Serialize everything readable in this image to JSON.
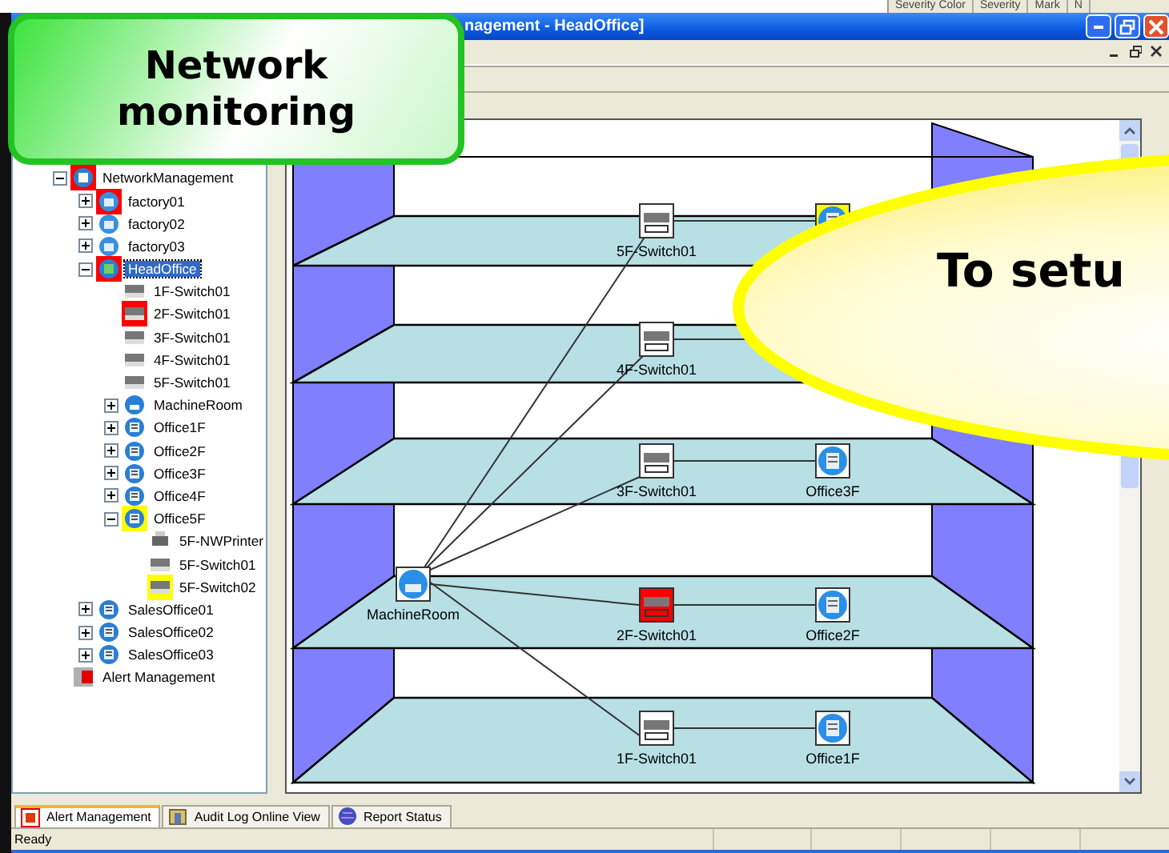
{
  "background_window": {
    "columns": [
      "Severity Color",
      "Severity",
      "Mark",
      "N"
    ]
  },
  "window": {
    "title": "nagement - HeadOffice]"
  },
  "tree": [
    {
      "label": "NetworkManagement",
      "kind": "root",
      "color": "#ff0000",
      "expanded": true,
      "selected": false,
      "children": [
        {
          "label": "factory01",
          "kind": "site",
          "color": "#ff0000",
          "expanded": false,
          "selected": false
        },
        {
          "label": "factory02",
          "kind": "site",
          "expanded": false,
          "selected": false
        },
        {
          "label": "factory03",
          "kind": "site",
          "expanded": false,
          "selected": false
        },
        {
          "label": "HeadOffice",
          "kind": "head",
          "color": "#ff0000",
          "expanded": true,
          "selected": true,
          "children": [
            {
              "label": "1F-Switch01",
              "kind": "switch",
              "selected": false
            },
            {
              "label": "2F-Switch01",
              "kind": "switch",
              "color": "#ff0000",
              "selected": false
            },
            {
              "label": "3F-Switch01",
              "kind": "switch",
              "selected": false
            },
            {
              "label": "4F-Switch01",
              "kind": "switch",
              "selected": false
            },
            {
              "label": "5F-Switch01",
              "kind": "switch",
              "selected": false
            },
            {
              "label": "MachineRoom",
              "kind": "room",
              "expanded": false,
              "selected": false
            },
            {
              "label": "Office1F",
              "kind": "office",
              "expanded": false,
              "selected": false
            },
            {
              "label": "Office2F",
              "kind": "office",
              "expanded": false,
              "selected": false
            },
            {
              "label": "Office3F",
              "kind": "office",
              "expanded": false,
              "selected": false
            },
            {
              "label": "Office4F",
              "kind": "office",
              "expanded": false,
              "selected": false
            },
            {
              "label": "Office5F",
              "kind": "office",
              "color": "#ffff00",
              "expanded": true,
              "selected": false,
              "children": [
                {
                  "label": "5F-NWPrinter",
                  "kind": "printer",
                  "selected": false
                },
                {
                  "label": "5F-Switch01",
                  "kind": "switch",
                  "selected": false
                },
                {
                  "label": "5F-Switch02",
                  "kind": "switch",
                  "color": "#ffff00",
                  "selected": false
                }
              ]
            }
          ]
        },
        {
          "label": "SalesOffice01",
          "kind": "office",
          "expanded": false,
          "selected": false
        },
        {
          "label": "SalesOffice02",
          "kind": "office",
          "expanded": false,
          "selected": false
        },
        {
          "label": "SalesOffice03",
          "kind": "office",
          "expanded": false,
          "selected": false
        }
      ]
    },
    {
      "label": "Alert Management",
      "kind": "alert",
      "selected": false
    }
  ],
  "floors": [
    {
      "nodes": [
        {
          "kind": "switch",
          "label": "5F-Switch01",
          "uplink": true
        },
        {
          "kind": "office",
          "color": "#ffff00"
        }
      ]
    },
    {
      "nodes": [
        {
          "kind": "switch",
          "label": "4F-Switch01",
          "uplink": true,
          "peer_link": true
        }
      ]
    },
    {
      "nodes": [
        {
          "kind": "switch",
          "label": "3F-Switch01",
          "uplink": true
        },
        {
          "kind": "office",
          "label": "Office3F"
        }
      ]
    },
    {
      "nodes": [
        {
          "kind": "room",
          "label": "MachineRoom"
        },
        {
          "kind": "switch",
          "label": "2F-Switch01",
          "color": "#ff0000"
        },
        {
          "kind": "office",
          "label": "Office2F"
        }
      ]
    },
    {
      "nodes": [
        {
          "kind": "switch",
          "label": "1F-Switch01",
          "uplink": true
        },
        {
          "kind": "office",
          "label": "Office1F"
        }
      ]
    }
  ],
  "tabs": [
    {
      "label": "Alert Management",
      "kind": "alert",
      "selected": true
    },
    {
      "label": "Audit Log Online View",
      "kind": "log",
      "selected": false
    },
    {
      "label": "Report Status",
      "kind": "report",
      "selected": false
    }
  ],
  "status_bar": {
    "text": "Ready"
  },
  "callouts": [
    {
      "kind": "box",
      "text": "Network monitoring"
    },
    {
      "kind": "bubble",
      "text": "To setu"
    }
  ]
}
